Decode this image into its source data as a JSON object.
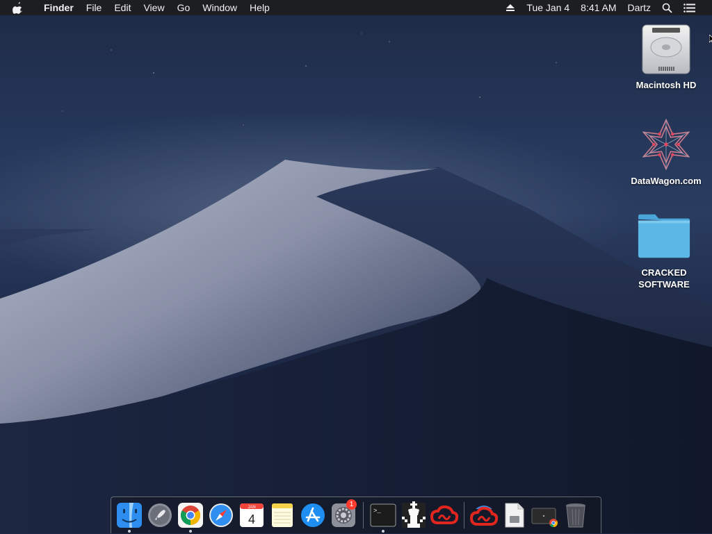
{
  "menubar": {
    "app_name": "Finder",
    "items": [
      "File",
      "Edit",
      "View",
      "Go",
      "Window",
      "Help"
    ],
    "date": "Tue Jan 4",
    "time": "8:41 AM",
    "user": "Dartz",
    "icons": [
      "apple-logo-icon",
      "eject-icon",
      "spotlight-search-icon",
      "notification-center-icon"
    ]
  },
  "desktop": {
    "icons": [
      {
        "label": "Macintosh HD",
        "icon": "hard-drive-icon"
      },
      {
        "label": "DataWagon.com",
        "icon": "datawagon-logo-icon"
      },
      {
        "label_line1": "CRACKED",
        "label_line2": "SOFTWARE",
        "icon": "folder-icon"
      }
    ]
  },
  "dock": {
    "apps": [
      {
        "name": "Finder",
        "icon": "finder-icon",
        "running": true
      },
      {
        "name": "Launchpad",
        "icon": "launchpad-rocket-icon",
        "running": false
      },
      {
        "name": "Google Chrome",
        "icon": "chrome-icon",
        "running": true
      },
      {
        "name": "Safari",
        "icon": "safari-compass-icon",
        "running": false
      },
      {
        "name": "Calendar",
        "icon": "calendar-icon",
        "running": false,
        "month": "JAN",
        "day": "4"
      },
      {
        "name": "Notes",
        "icon": "notes-icon",
        "running": false
      },
      {
        "name": "App Store",
        "icon": "app-store-icon",
        "running": false
      },
      {
        "name": "System Preferences",
        "icon": "system-preferences-gear-icon",
        "running": false,
        "badge": "1"
      },
      {
        "name": "Terminal",
        "icon": "terminal-icon",
        "running": true,
        "prompt": ">_"
      },
      {
        "name": "Chess",
        "icon": "chess-king-icon",
        "running": false
      },
      {
        "name": "Creative Cloud",
        "icon": "creative-cloud-icon",
        "running": false
      },
      {
        "name": "Creative Cloud Installer",
        "icon": "creative-cloud-installer-icon",
        "running": false
      },
      {
        "name": "Document",
        "icon": "document-file-icon",
        "running": false
      },
      {
        "name": "Chrome Download",
        "icon": "chrome-download-icon",
        "running": false
      },
      {
        "name": "Trash",
        "icon": "trash-icon",
        "running": false
      }
    ]
  },
  "colors": {
    "menubar_bg": "#1d1e21",
    "badge": "#ff3b30",
    "folder": "#5bb8e6",
    "creative_cloud": "#e0261f"
  }
}
